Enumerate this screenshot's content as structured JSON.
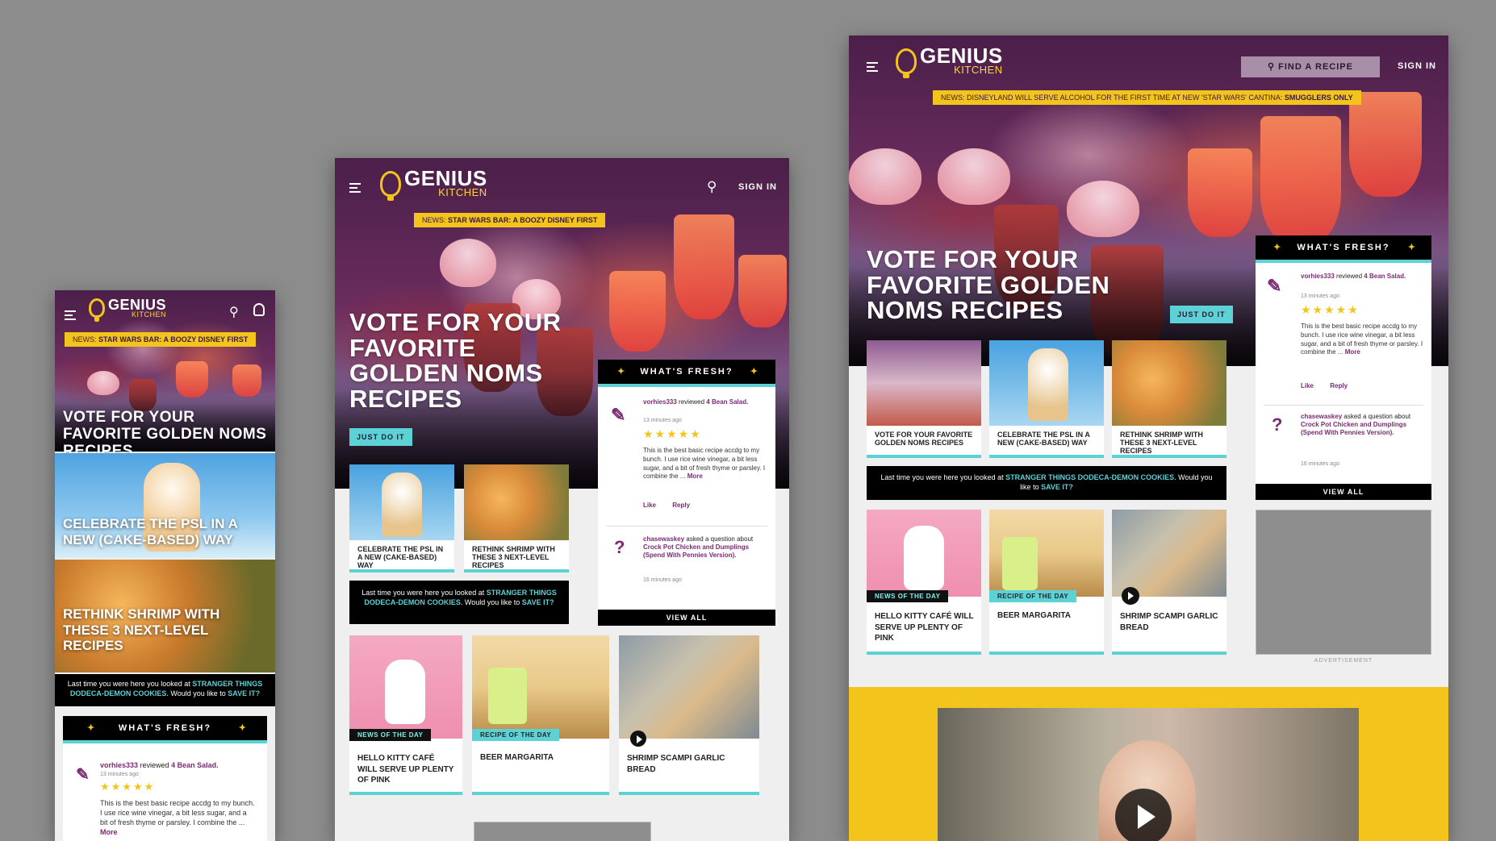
{
  "brand": {
    "name_line1": "GENIUS",
    "name_line2": "KITCHEN",
    "accent": "#f3c41b",
    "purple": "#7b2a73",
    "cyan": "#5cd1d6"
  },
  "header": {
    "sign_in": "SIGN IN",
    "find_recipe": "FIND A RECIPE",
    "menu_icon": "hamburger-icon",
    "search_icon": "search-icon",
    "user_icon": "user-icon"
  },
  "news": {
    "prefix": "NEWS:",
    "mobile": "STAR WARS BAR: A BOOZY DISNEY FIRST",
    "tablet": "STAR WARS BAR: A BOOZY DISNEY FIRST",
    "desktop_plain": "DISNEYLAND WILL SERVE ALCOHOL FOR THE FIRST TIME AT NEW 'STAR WARS' CANTINA:",
    "desktop_bold": "SMUGGLERS ONLY"
  },
  "hero": {
    "mobile_title": "VOTE FOR YOUR FAVORITE GOLDEN NOMS RECIPES",
    "title_lines_tablet": [
      "VOTE FOR YOUR",
      "FAVORITE",
      "GOLDEN NOMS",
      "RECIPES"
    ],
    "title_lines_desktop": [
      "VOTE FOR YOUR",
      "FAVORITE GOLDEN",
      "NOMS RECIPES"
    ],
    "cta": "JUST DO IT"
  },
  "mobile_tiles": [
    {
      "title": "CELEBRATE THE PSL IN A NEW (CAKE-BASED) WAY"
    },
    {
      "title": "RETHINK SHRIMP WITH THESE 3 NEXT-LEVEL RECIPES"
    }
  ],
  "cards": {
    "vote": "VOTE FOR YOUR FAVORITE GOLDEN NOMS RECIPES",
    "psl": "CELEBRATE THE PSL IN A NEW (CAKE-BASED) WAY",
    "shrimp": "RETHINK SHRIMP WITH THESE 3 NEXT-LEVEL RECIPES",
    "kitty_tag": "NEWS OF THE DAY",
    "kitty": "HELLO KITTY CAFÉ WILL SERVE UP PLENTY OF PINK",
    "marg_tag": "RECIPE OF THE DAY",
    "marg": "BEER MARGARITA",
    "scampi": "SHRIMP SCAMPI GARLIC BREAD"
  },
  "last_visit": {
    "text1": "Last time you were here you looked at",
    "link": "STRANGER THINGS DODECA-DEMON COOKIES",
    "text2": ". Would you like to",
    "save": "SAVE IT?"
  },
  "fresh": {
    "title": "WHAT'S FRESH?",
    "sparkle": "✦",
    "review_user": "vorhies333",
    "review_verb": "reviewed",
    "review_target": "4 Bean Salad.",
    "review_time": "13 minutes ago",
    "stars": "★★★★★",
    "review_body": "This is the best basic recipe accdg to my bunch. I use rice wine vinegar, a bit less sugar, and a bit of fresh thyme or parsley. I combine the ...",
    "more": "More",
    "like": "Like",
    "reply": "Reply",
    "question_user": "chasewaskey",
    "question_verb": "asked a question about",
    "question_target": "Crock Pot Chicken and Dumplings (Spend With Pennies Version).",
    "question_time": "16 minutes ago",
    "question_icon": "?",
    "view_all": "VIEW ALL"
  },
  "ad": {
    "label": "ADVERTISEMENT"
  }
}
